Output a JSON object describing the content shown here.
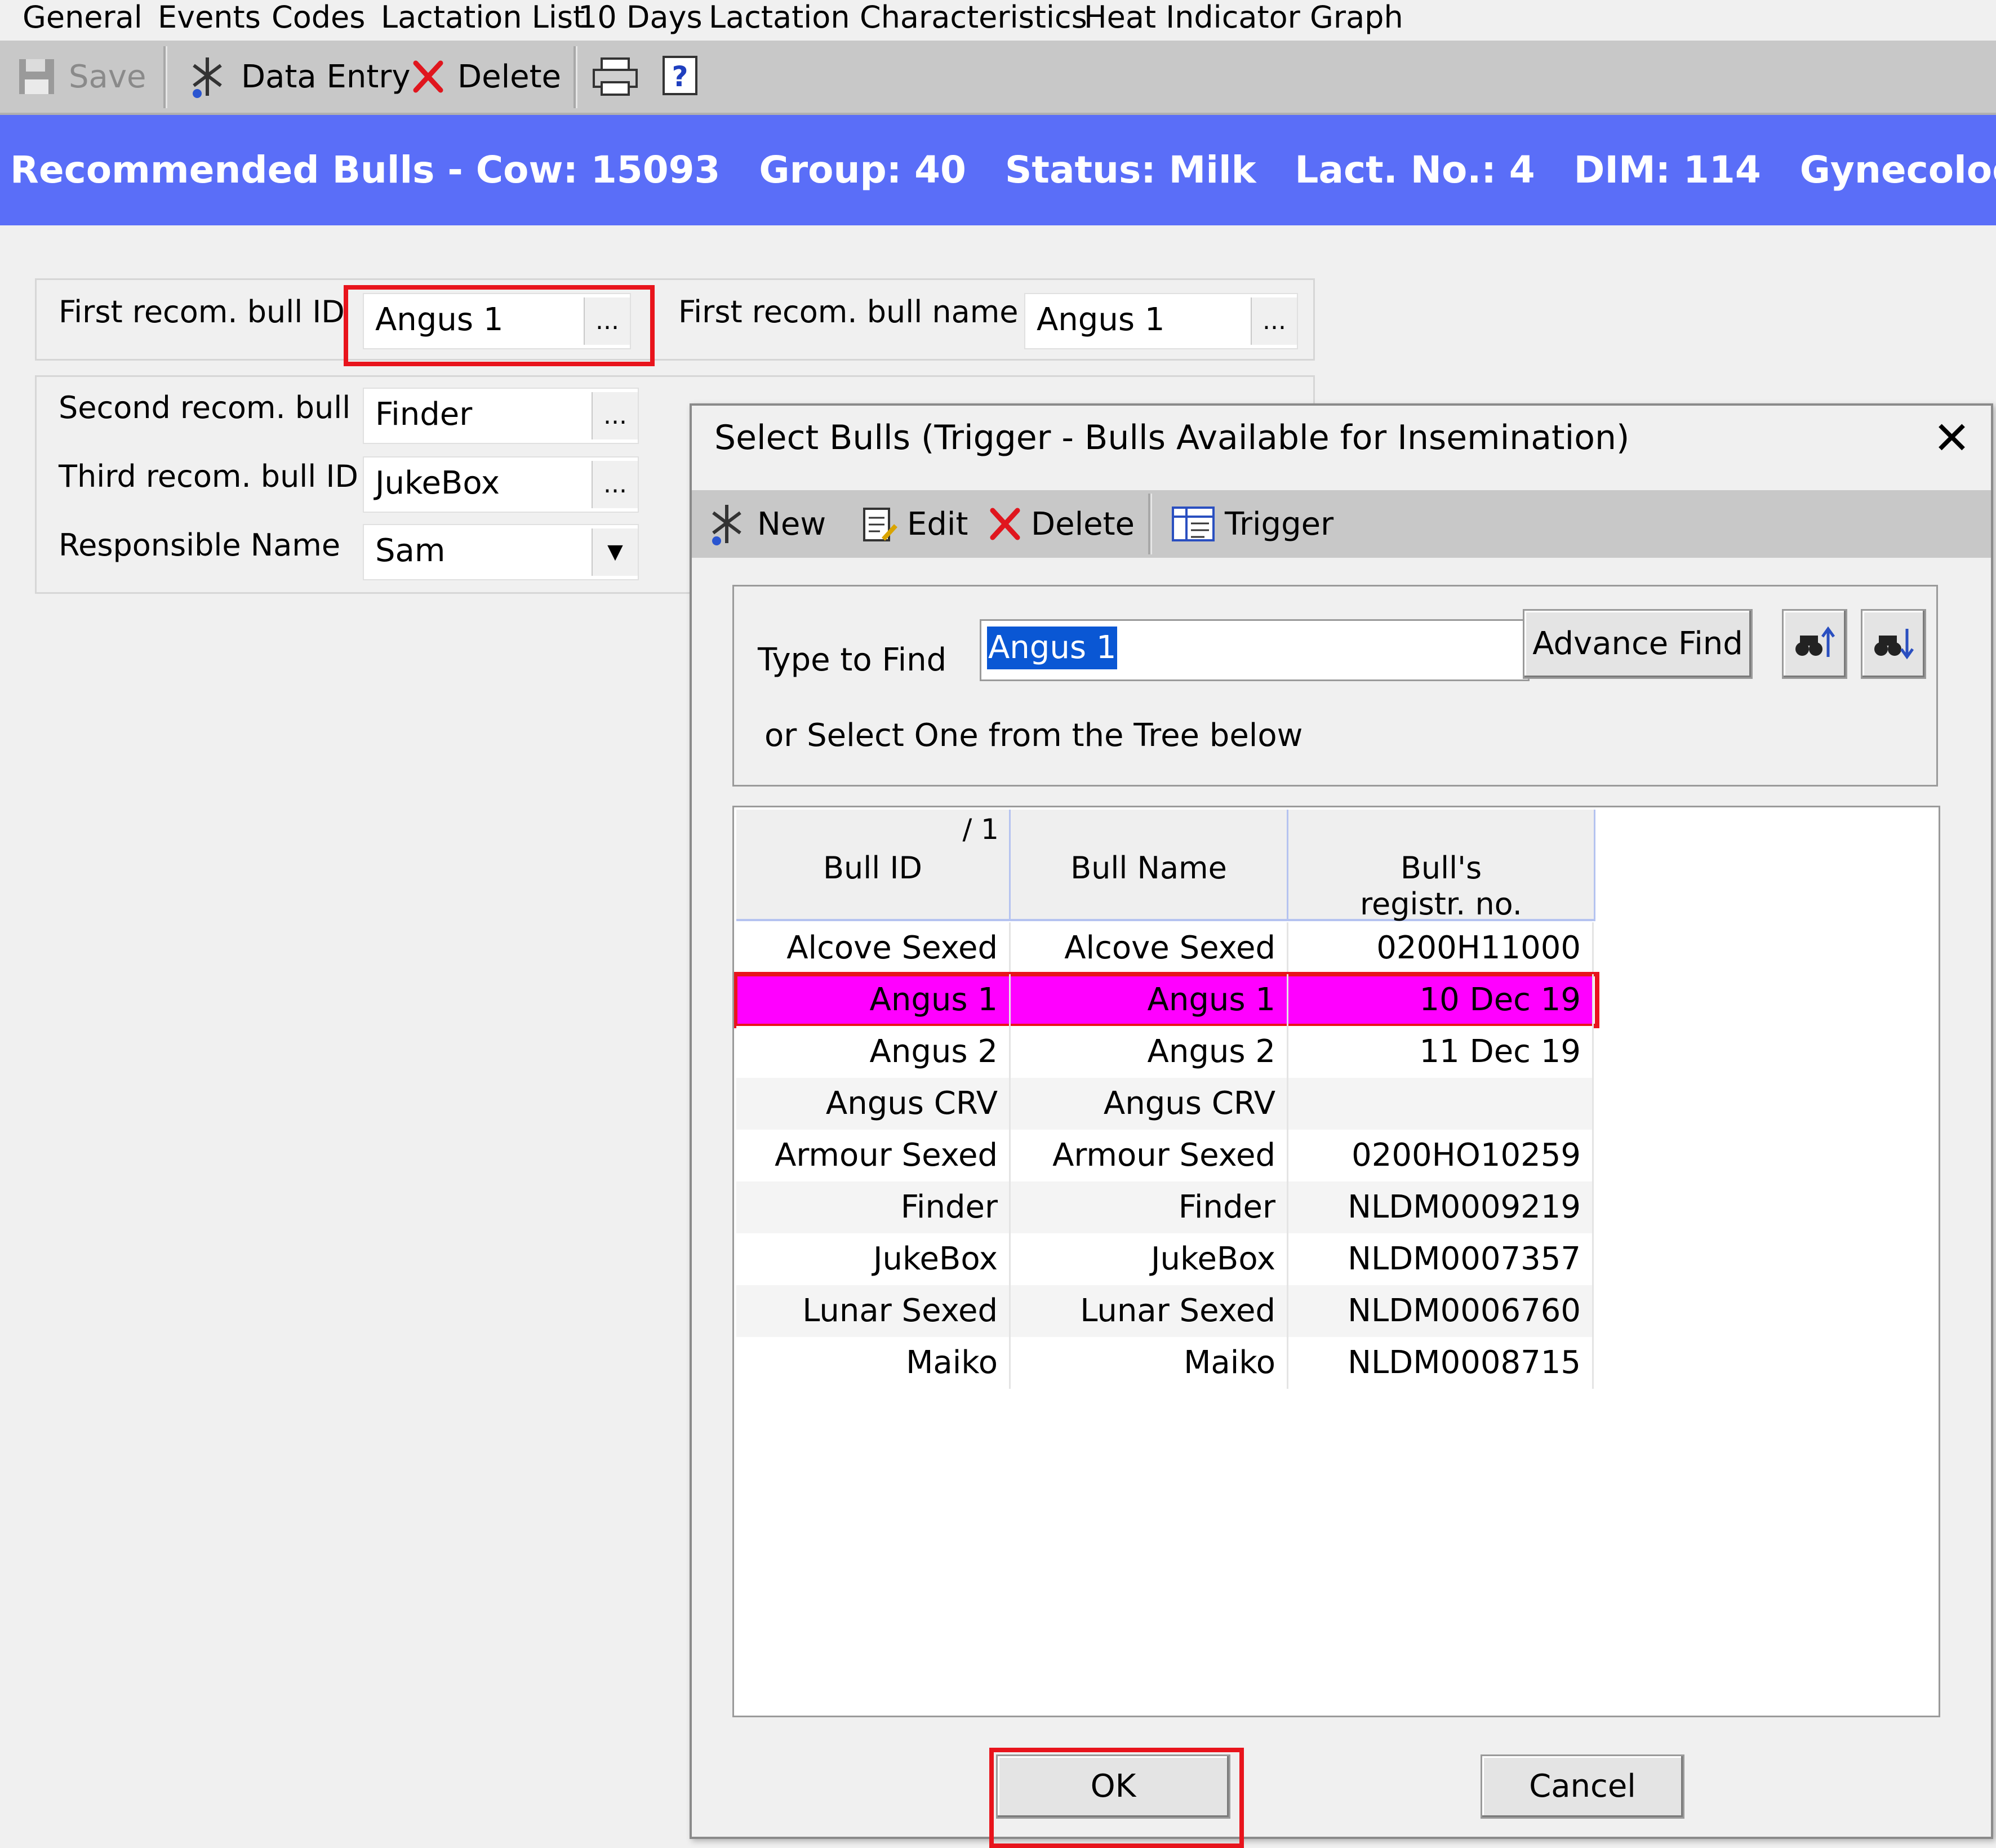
{
  "menu": [
    "General",
    "Events",
    "Codes",
    "Lactation List",
    "10 Days",
    "Lactation",
    "Characteristics",
    "Heat Indicator Graph"
  ],
  "toolbar": {
    "save": "Save",
    "data_entry": "Data Entry",
    "delete": "Delete"
  },
  "header": {
    "title": "Recommended Bulls - Cow: 15093   Group: 40   Status: Milk   Lact. No.: 4   DIM: 114   Gynecological Status:"
  },
  "form": {
    "first_id_label": "First recom. bull ID",
    "first_id_value": "Angus 1",
    "first_name_label": "First recom. bull name",
    "first_name_value": "Angus 1",
    "second_id_label": "Second recom. bull ID",
    "second_id_value": "Finder",
    "third_id_label": "Third recom. bull ID",
    "third_id_value": "JukeBox",
    "responsible_label": "Responsible Name",
    "responsible_value": "Sam",
    "dots": "..."
  },
  "dialog": {
    "title": "Select Bulls (Trigger - Bulls Available for Insemination)",
    "close": "✕",
    "toolbar": {
      "new": "New",
      "edit": "Edit",
      "delete": "Delete",
      "trigger": "Trigger"
    },
    "find_label": "Type to Find",
    "find_value": "Angus 1",
    "advance_find": "Advance Find",
    "tree_hint": "or Select One from the Tree below",
    "columns": {
      "bull_id": "Bull ID",
      "sort_indicator": "/ 1",
      "bull_name": "Bull Name",
      "registr_line1": "Bull's",
      "registr_line2": "registr. no."
    },
    "rows": [
      {
        "id": "Alcove Sexed",
        "name": "Alcove Sexed",
        "reg": "0200H11000"
      },
      {
        "id": "Angus 1",
        "name": "Angus 1",
        "reg": "10 Dec 19"
      },
      {
        "id": "Angus 2",
        "name": "Angus 2",
        "reg": "11 Dec 19"
      },
      {
        "id": "Angus CRV",
        "name": "Angus CRV",
        "reg": ""
      },
      {
        "id": "Armour Sexed",
        "name": "Armour Sexed",
        "reg": "0200HO10259"
      },
      {
        "id": "Finder",
        "name": "Finder",
        "reg": "NLDM0009219"
      },
      {
        "id": "JukeBox",
        "name": "JukeBox",
        "reg": "NLDM0007357"
      },
      {
        "id": "Lunar Sexed",
        "name": "Lunar Sexed",
        "reg": "NLDM0006760"
      },
      {
        "id": "Maiko",
        "name": "Maiko",
        "reg": "NLDM0008715"
      }
    ],
    "ok": "OK",
    "cancel": "Cancel"
  },
  "colors": {
    "header_bg": "#5a6ef8",
    "selected_row": "#ff00ff",
    "highlight_border": "#e8141c"
  }
}
